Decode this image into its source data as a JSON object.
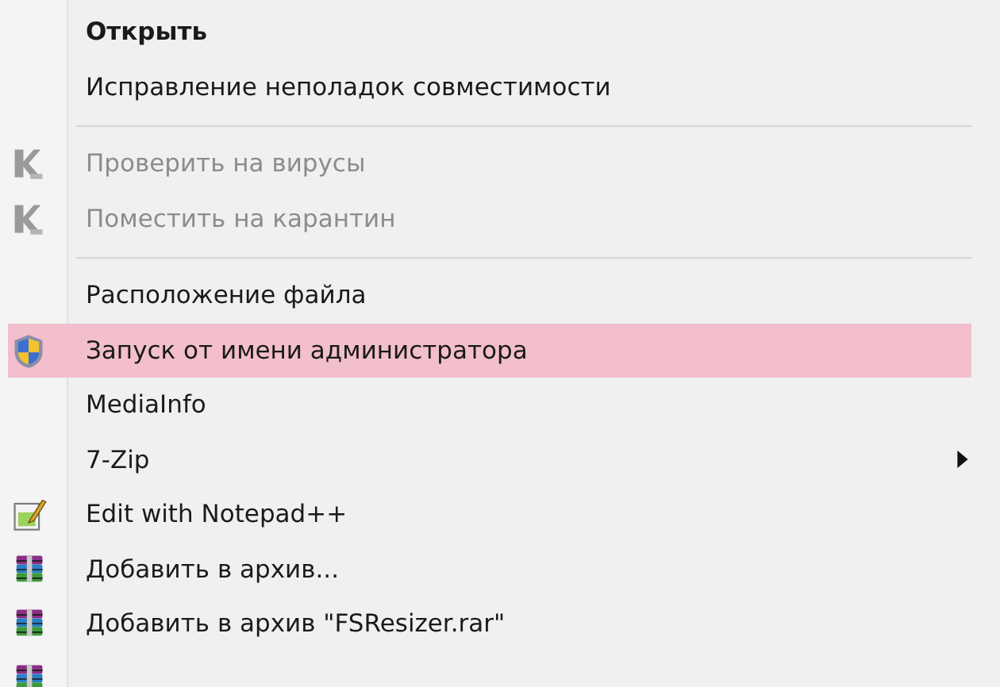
{
  "menu": {
    "items": [
      {
        "kind": "text",
        "label": "Открыть",
        "default": true,
        "disabled": false,
        "selected": false
      },
      {
        "kind": "text",
        "label": "Исправление неполадок совместимости",
        "default": false,
        "disabled": false,
        "selected": false
      },
      {
        "kind": "separator"
      },
      {
        "kind": "scan",
        "label": "Проверить на вирусы",
        "default": false,
        "disabled": true,
        "selected": false
      },
      {
        "kind": "scan",
        "label": "Поместить на карантин",
        "default": false,
        "disabled": true,
        "selected": false
      },
      {
        "kind": "separator"
      },
      {
        "kind": "text",
        "label": "Расположение файла",
        "default": false,
        "disabled": false,
        "selected": false
      },
      {
        "kind": "shield",
        "label": "Запуск от имени администратора",
        "default": false,
        "disabled": false,
        "selected": true
      },
      {
        "kind": "text",
        "label": "MediaInfo",
        "default": false,
        "disabled": false,
        "selected": false
      },
      {
        "kind": "text",
        "label": "7-Zip",
        "default": false,
        "disabled": false,
        "selected": false,
        "submenu": true
      },
      {
        "kind": "editor",
        "label": "Edit with Notepad++",
        "default": false,
        "disabled": false,
        "selected": false
      },
      {
        "kind": "archive",
        "label": "Добавить в архив...",
        "default": false,
        "disabled": false,
        "selected": false
      },
      {
        "kind": "archive",
        "label": "Добавить в архив \"FSResizer.rar\"",
        "default": false,
        "disabled": false,
        "selected": false
      },
      {
        "kind": "archive",
        "selected": false
      }
    ]
  }
}
